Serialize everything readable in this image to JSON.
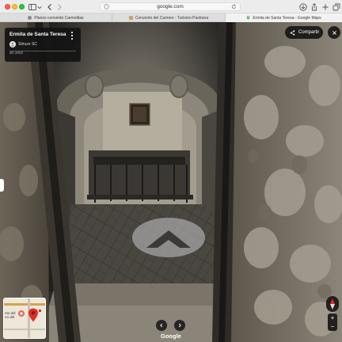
{
  "browser": {
    "url": "google.com",
    "tabs": [
      {
        "label": "Planos convento Carmelitas",
        "active": false
      },
      {
        "label": "Convento del Carmen - Turismo Pastrana",
        "active": false
      },
      {
        "label": "Ermita de Santa Teresa - Google Maps",
        "active": true
      }
    ]
  },
  "place": {
    "title": "Ermita de Santa Teresa",
    "author": "Stiruze SC",
    "date": "dic 2022"
  },
  "controls": {
    "share_label": "Compartir",
    "zoom_in": "+",
    "zoom_out": "−"
  },
  "minimap": {
    "label": "nto del\nno del"
  },
  "brand": {
    "logo_text": "Google"
  },
  "colors": {
    "overlay": "#141414",
    "pin": "#d93025",
    "map_bg": "#ede7d9",
    "map_road": "#d5a24c"
  }
}
